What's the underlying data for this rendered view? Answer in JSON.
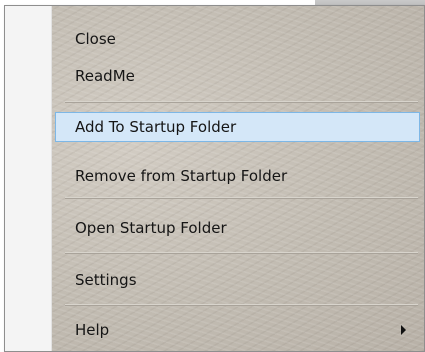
{
  "menu": {
    "items": [
      {
        "label": "Close"
      },
      {
        "label": "ReadMe"
      },
      {
        "label": "Add To Startup Folder",
        "highlighted": true
      },
      {
        "label": "Remove from Startup Folder"
      },
      {
        "label": "Open Startup Folder"
      },
      {
        "label": "Settings"
      },
      {
        "label": "Help",
        "has_submenu": true,
        "submenu_icon": "chevron-right-icon"
      }
    ],
    "highlight_color": "#d4e7f8",
    "highlight_border_color": "#7db7e6"
  }
}
